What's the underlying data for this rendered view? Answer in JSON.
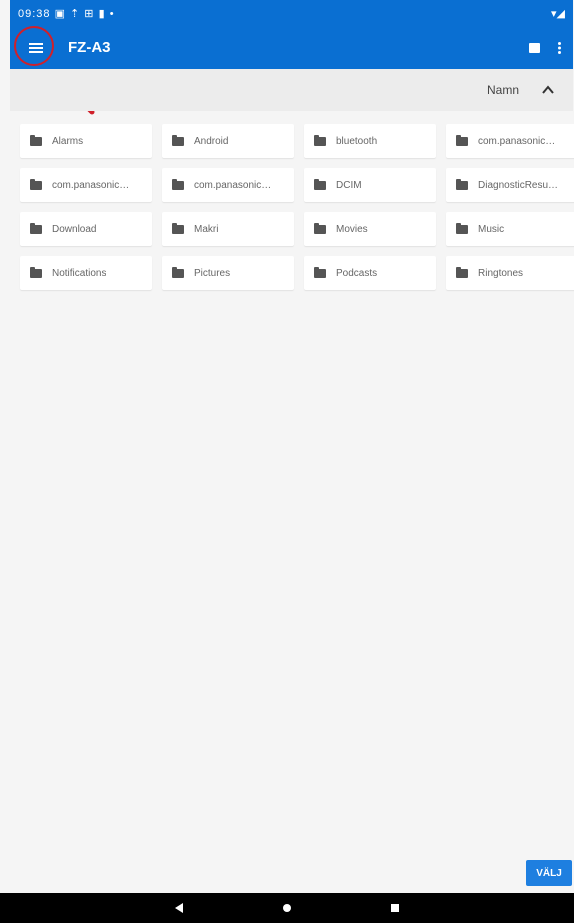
{
  "statusbar": {
    "left": "09:38 ▣ ⇡ ⊞ ▮ •",
    "right": "▾◢"
  },
  "appbar": {
    "title": "FZ-A3"
  },
  "sort": {
    "label": "Namn"
  },
  "folders": [
    "Alarms",
    "Android",
    "bluetooth",
    "com.panasonic…",
    "com.panasonic…",
    "com.panasonic…",
    "DCIM",
    "DiagnosticResu…",
    "Download",
    "Makri",
    "Movies",
    "Music",
    "Notifications",
    "Pictures",
    "Podcasts",
    "Ringtones"
  ],
  "actions": {
    "select_label": "VÄLJ"
  },
  "colors": {
    "primary": "#0a6fd2",
    "accent": "#1e7fe0",
    "annotation": "#d0202a"
  }
}
